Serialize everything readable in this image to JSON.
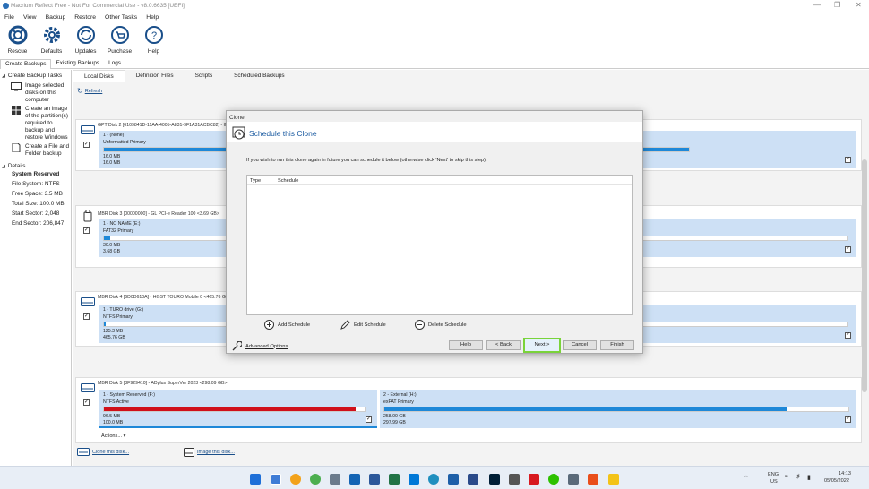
{
  "window": {
    "title": "Macrium Reflect Free - Not For Commercial Use - v8.0.6635  [UEFI]"
  },
  "menu": [
    "File",
    "View",
    "Backup",
    "Restore",
    "Other Tasks",
    "Help"
  ],
  "toolbar": [
    {
      "label": "Rescue",
      "icon": "rescue-icon"
    },
    {
      "label": "Defaults",
      "icon": "gear-icon"
    },
    {
      "label": "Updates",
      "icon": "updates-icon"
    },
    {
      "label": "Purchase",
      "icon": "cart-icon"
    },
    {
      "label": "Help",
      "icon": "help-icon"
    }
  ],
  "main_tabs": [
    "Create Backups",
    "Existing Backups",
    "Logs"
  ],
  "left": {
    "tasks_header": "Create Backup Tasks",
    "tasks": [
      "Image selected disks on this computer",
      "Create an image of the partition(s) required to backup and restore Windows",
      "Create a File and Folder backup"
    ],
    "details_header": "Details",
    "details": [
      "System Reserved",
      "File System: NTFS",
      "Free Space:  3.5 MB",
      "Total Size:  100.0 MB",
      "Start Sector:  2,048",
      "End Sector:  206,847"
    ]
  },
  "sub_tabs": [
    "Local Disks",
    "Definition Files",
    "Scripts",
    "Scheduled Backups"
  ],
  "refresh": "Refresh",
  "disks": [
    {
      "header": "GPT Disk 2 [6109841D-11AA-4005-A831-9F1A31ACBC82] - INTE",
      "parts": [
        {
          "name": "1 - (None)",
          "type": "Unformatted Primary",
          "used": "16.0 MB",
          "total": "16.0 MB"
        }
      ]
    },
    {
      "header": "MBR Disk 3 [00000000] - GL PCI-e Reader 100  <3.69 GB>",
      "parts": [
        {
          "name": "1 - NO NAME (E:)",
          "type": "FAT32 Primary",
          "used": "30.0 MB",
          "total": "3.68 GB"
        }
      ]
    },
    {
      "header": "MBR Disk 4 [6D0D610A] - HGST    TOURO Mobile    0  <465.76 G",
      "parts": [
        {
          "name": "1 - TURO drive (G:)",
          "type": "NTFS Primary",
          "used": "125.3 MB",
          "total": "465.76 GB"
        }
      ]
    },
    {
      "header": "MBR Disk 5 [3F929410] - ADplus  SuperVer 2023  <298.09 GB>",
      "parts": [
        {
          "name": "1 - System Reserved (F:)",
          "type": "NTFS Active",
          "used": "96.5 MB",
          "total": "100.0 MB"
        },
        {
          "name": "2 - External (H:)",
          "type": "exFAT Primary",
          "used": "258.00 GB",
          "total": "297.99 GB"
        }
      ],
      "actions": "Actions..."
    }
  ],
  "bottom_links": {
    "clone": "Clone this disk...",
    "image": "Image this disk..."
  },
  "dialog": {
    "title": "Clone",
    "heading": "Schedule this Clone",
    "info": "If you wish to run this clone again in future you can schedule it below (otherwise click 'Next' to skip this step):",
    "columns": [
      "Type",
      "Schedule"
    ],
    "add": "Add Schedule",
    "edit": "Edit Schedule",
    "delete": "Delete Schedule",
    "advanced": "Advanced Options",
    "buttons": {
      "help": "Help",
      "back": "< Back",
      "next": "Next >",
      "cancel": "Cancel",
      "finish": "Finish"
    }
  },
  "tray": {
    "lang1": "ENG",
    "lang2": "US",
    "time": "14:13",
    "date": "05/05/2022"
  },
  "colors": {
    "accent": "#1e88d8",
    "partition_bg": "#cde0f5",
    "system_reserved_fill": "#d0101a",
    "highlight": "#7ad33a"
  }
}
